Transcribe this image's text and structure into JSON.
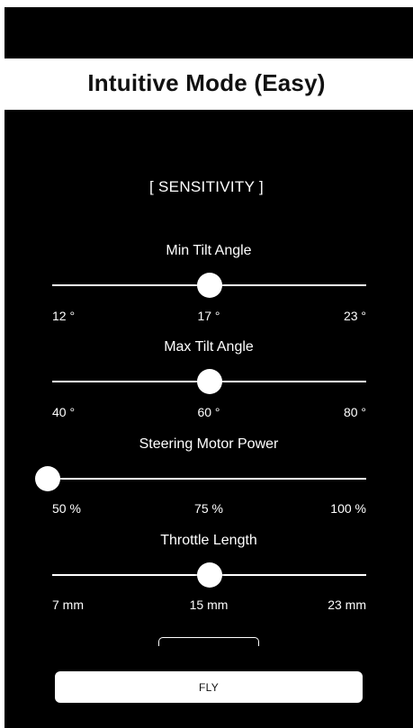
{
  "header": {
    "title": "Intuitive Mode (Easy)"
  },
  "sensitivity": {
    "section_title": "[ SENSITIVITY ]",
    "sliders": [
      {
        "label": "Min Tilt Angle",
        "min_label": "12 °",
        "mid_label": "17 °",
        "max_label": "23 °",
        "value_fraction": 0.5
      },
      {
        "label": "Max Tilt Angle",
        "min_label": "40 °",
        "mid_label": "60 °",
        "max_label": "80 °",
        "value_fraction": 0.5
      },
      {
        "label": "Steering Motor Power",
        "min_label": "50 %",
        "mid_label": "75 %",
        "max_label": "100 %",
        "value_fraction": 0.0
      },
      {
        "label": "Throttle Length",
        "min_label": "7 mm",
        "mid_label": "15 mm",
        "max_label": "23 mm",
        "value_fraction": 0.5
      }
    ]
  },
  "actions": {
    "fly_label": "FLY"
  }
}
